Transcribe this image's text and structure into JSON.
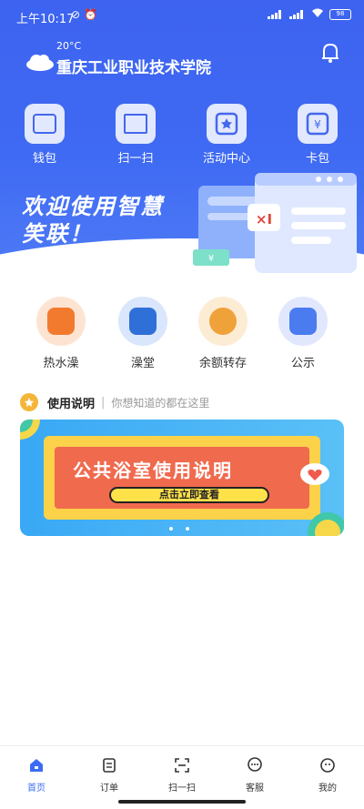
{
  "status_bar": {
    "time": "上午10:17",
    "battery": "98"
  },
  "header": {
    "temperature": "20°C",
    "school_name": "重庆工业职业技术学院"
  },
  "quick_actions": [
    {
      "label": "钱包",
      "icon": "wallet-icon"
    },
    {
      "label": "扫一扫",
      "icon": "scan-icon"
    },
    {
      "label": "活动中心",
      "icon": "star-icon"
    },
    {
      "label": "卡包",
      "icon": "card-icon"
    }
  ],
  "banner": {
    "line1": "欢迎使用智慧",
    "line2": "笑联！"
  },
  "services": [
    {
      "label": "热水澡",
      "icon": "shower-icon",
      "color": "#f27a2e"
    },
    {
      "label": "澡堂",
      "icon": "bathhouse-icon",
      "color": "#2f6fd8"
    },
    {
      "label": "余额转存",
      "icon": "money-bag-icon",
      "color": "#f0a23a"
    },
    {
      "label": "公示",
      "icon": "briefcase-icon",
      "color": "#4a7cf0"
    }
  ],
  "guide": {
    "title": "使用说明",
    "subtitle": "你想知道的都在这里"
  },
  "promo_card": {
    "title": "公共浴室使用说明",
    "button": "点击立即查看"
  },
  "tab_bar": [
    {
      "label": "首页",
      "icon": "home-icon",
      "active": true
    },
    {
      "label": "订单",
      "icon": "order-icon",
      "active": false
    },
    {
      "label": "扫一扫",
      "icon": "scan-icon",
      "active": false
    },
    {
      "label": "客服",
      "icon": "chat-icon",
      "active": false
    },
    {
      "label": "我的",
      "icon": "profile-icon",
      "active": false
    }
  ],
  "colors": {
    "primary": "#3f6af3",
    "accent_active": "#3b6cf5"
  }
}
